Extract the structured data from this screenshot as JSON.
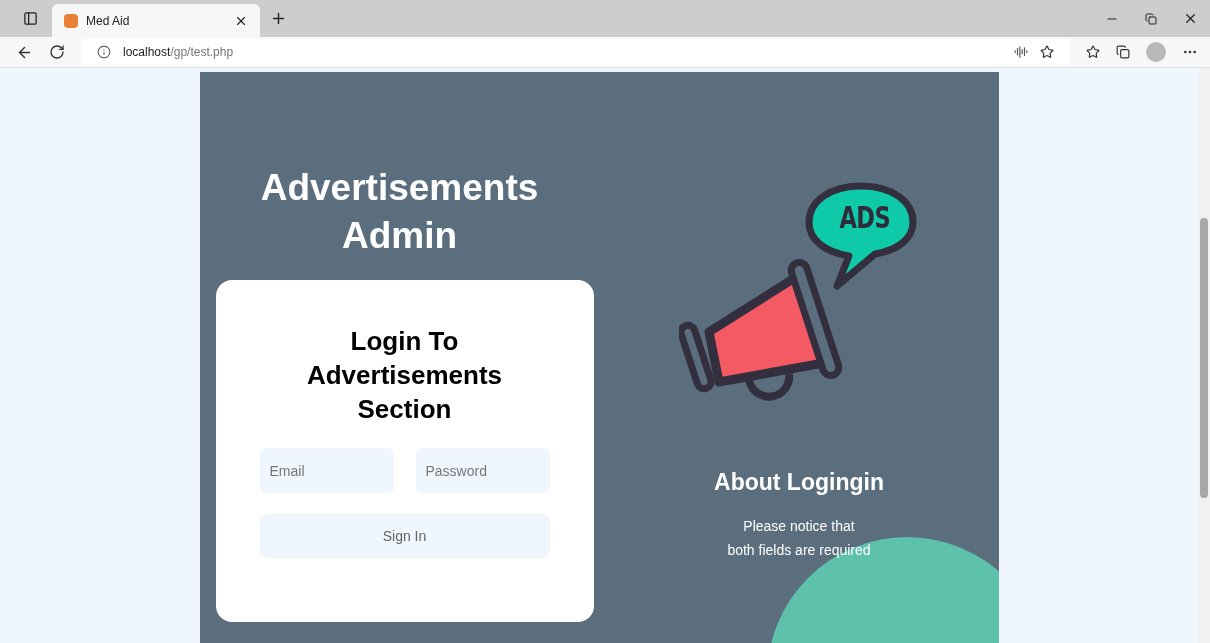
{
  "browser": {
    "tab": {
      "title": "Med Aid",
      "selected": true
    },
    "url": {
      "host": "localhost",
      "path": "/gp/test.php"
    }
  },
  "hero": {
    "title_lines": [
      "Advertisements",
      "Admin"
    ]
  },
  "login": {
    "heading_lines": [
      "Login To",
      "Advertisements",
      "Section"
    ],
    "fields": [
      {
        "placeholder": "Email"
      },
      {
        "placeholder": "Password"
      }
    ],
    "button": "Sign In"
  },
  "ad_badge": "ADS",
  "about": {
    "title": "About Logingin",
    "lines": [
      "Please notice that",
      "both fields are required"
    ]
  }
}
